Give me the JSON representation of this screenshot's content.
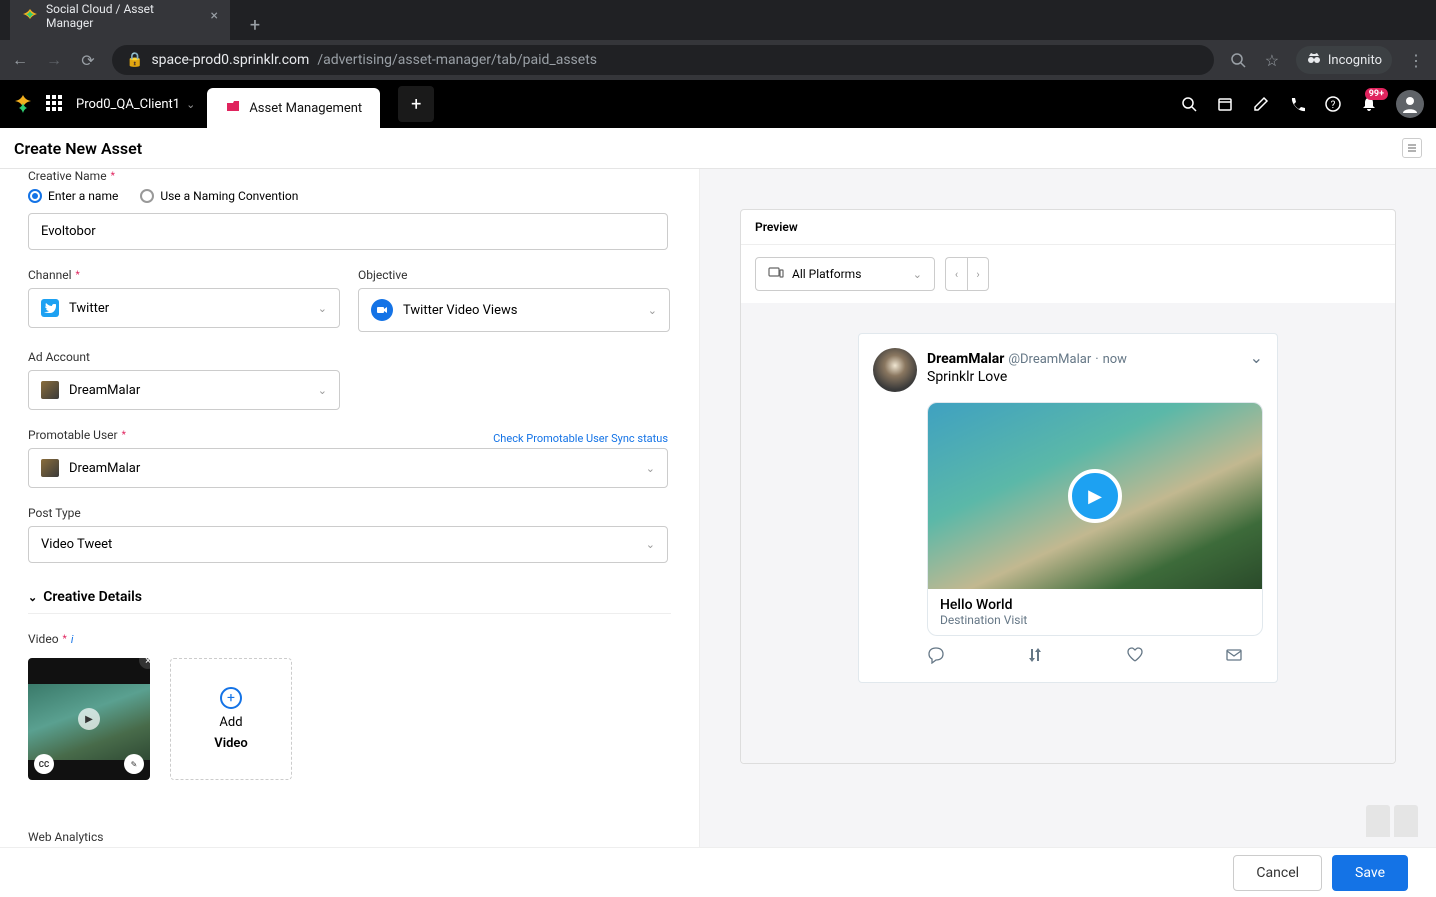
{
  "browser": {
    "tab_title": "Social Cloud / Asset Manager",
    "url_host": "space-prod0.sprinklr.com",
    "url_path": "/advertising/asset-manager/tab/paid_assets",
    "incognito": "Incognito"
  },
  "app_bar": {
    "client": "Prod0_QA_Client1",
    "tab_label": "Asset Management",
    "notif_count": "99+"
  },
  "page": {
    "title": "Create New Asset"
  },
  "form": {
    "creative_name": {
      "label": "Creative Name",
      "radio_enter": "Enter a name",
      "radio_convention": "Use a Naming Convention",
      "value": "Evoltobor"
    },
    "channel": {
      "label": "Channel",
      "value": "Twitter"
    },
    "objective": {
      "label": "Objective",
      "value": "Twitter Video Views"
    },
    "ad_account": {
      "label": "Ad Account",
      "value": "DreamMalar"
    },
    "promotable_user": {
      "label": "Promotable User",
      "value": "DreamMalar",
      "sync_link": "Check Promotable User Sync status"
    },
    "post_type": {
      "label": "Post Type",
      "value": "Video Tweet"
    },
    "creative_details": {
      "title": "Creative Details"
    },
    "video": {
      "label": "Video",
      "add_label_1": "Add",
      "add_label_2": "Video",
      "cc_label": "CC"
    },
    "web_analytics": {
      "label": "Web Analytics"
    }
  },
  "preview": {
    "title": "Preview",
    "platform": "All Platforms",
    "tweet": {
      "name": "DreamMalar",
      "handle": "@DreamMalar",
      "sep": "·",
      "time": "now",
      "text": "Sprinklr Love",
      "card_title": "Hello World",
      "card_sub": "Destination Visit"
    }
  },
  "footer": {
    "cancel": "Cancel",
    "save": "Save"
  }
}
